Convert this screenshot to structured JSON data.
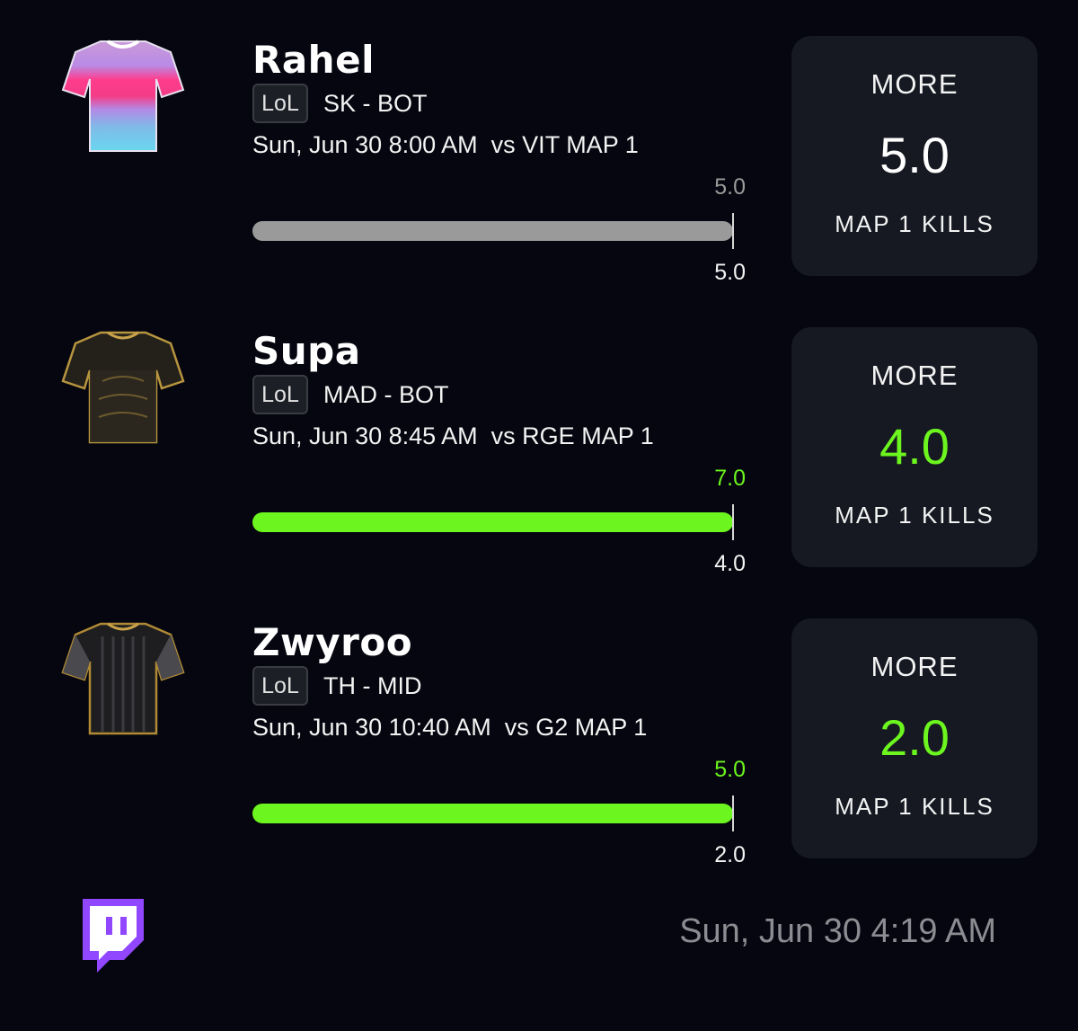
{
  "colors": {
    "accent_green": "#6cf51e",
    "neutral_gray": "#9a9a9a",
    "card_bg": "#161922",
    "page_bg": "#05060f"
  },
  "picks": [
    {
      "player": "Rahel",
      "game_badge": "LoL",
      "team_position": "SK - BOT",
      "schedule": "Sun, Jun 30 8:00 AM  vs VIT MAP 1",
      "bar_top_value": "5.0",
      "bar_bottom_value": "5.0",
      "bar_fill_fraction": 1.0,
      "bar_color": "#9a9a9a",
      "direction": "MORE",
      "line": "5.0",
      "line_color": "#ffffff",
      "stat": "MAP 1 KILLS",
      "jersey_icon": "jersey-pink-blue-icon"
    },
    {
      "player": "Supa",
      "game_badge": "LoL",
      "team_position": "MAD - BOT",
      "schedule": "Sun, Jun 30 8:45 AM  vs RGE MAP 1",
      "bar_top_value": "7.0",
      "bar_bottom_value": "4.0",
      "bar_fill_fraction": 1.0,
      "bar_color": "#6cf51e",
      "direction": "MORE",
      "line": "4.0",
      "line_color": "#6cf51e",
      "stat": "MAP 1 KILLS",
      "jersey_icon": "jersey-black-gold-icon"
    },
    {
      "player": "Zwyroo",
      "game_badge": "LoL",
      "team_position": "TH - MID",
      "schedule": "Sun, Jun 30 10:40 AM  vs G2 MAP 1",
      "bar_top_value": "5.0",
      "bar_bottom_value": "2.0",
      "bar_fill_fraction": 1.0,
      "bar_color": "#6cf51e",
      "direction": "MORE",
      "line": "2.0",
      "line_color": "#6cf51e",
      "stat": "MAP 1 KILLS",
      "jersey_icon": "jersey-black-pattern-icon"
    }
  ],
  "footer": {
    "logo_icon": "twitch-icon",
    "timestamp": "Sun, Jun 30 4:19 AM"
  }
}
